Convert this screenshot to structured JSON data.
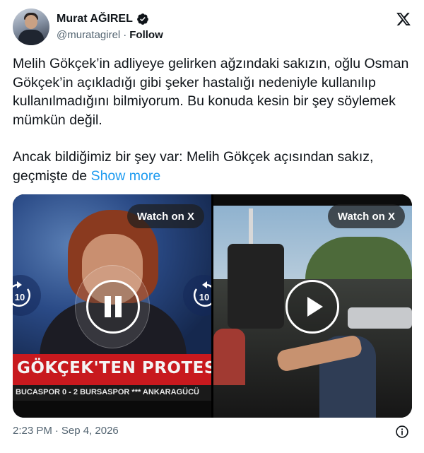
{
  "author": {
    "name": "Murat AĞIREL",
    "handle": "@muratagirel",
    "separator": "·",
    "follow_label": "Follow"
  },
  "tweet": {
    "paragraph1": "Melih Gökçek’in adliyeye gelirken ağzındaki sakızın, oğlu Osman Gökçek’in açıkladığı gibi şeker hastalığı nedeniyle kullanılıp kullanılmadığını bilmiyorum. Bu konuda kesin bir şey söylemek mümkün değil.",
    "paragraph2": "Ancak bildiğimiz bir şey var: Melih Gökçek açısından sakız, geçmişte de",
    "show_more": "Show more"
  },
  "media": {
    "left": {
      "watch_label": "Watch on X",
      "banner": "GÖKÇEK'TEN PROTEST",
      "ticker": "BUCASPOR 0 - 2 BURSASPOR *** ANKARAGÜCÜ",
      "seek_back": "10",
      "seek_forward": "10"
    },
    "right": {
      "watch_label": "Watch on X"
    }
  },
  "meta": {
    "time": "2:23 PM",
    "separator": "·",
    "date": "Sep 4, 2026"
  },
  "colors": {
    "link": "#1d9bf0",
    "verified": "#1d9bf0",
    "banner_red": "#c8191e",
    "secondary_text": "#536471"
  },
  "icons": [
    "verified-badge-icon",
    "x-logo-icon",
    "replay-10-icon",
    "forward-10-icon",
    "pause-icon",
    "play-icon",
    "info-icon"
  ]
}
